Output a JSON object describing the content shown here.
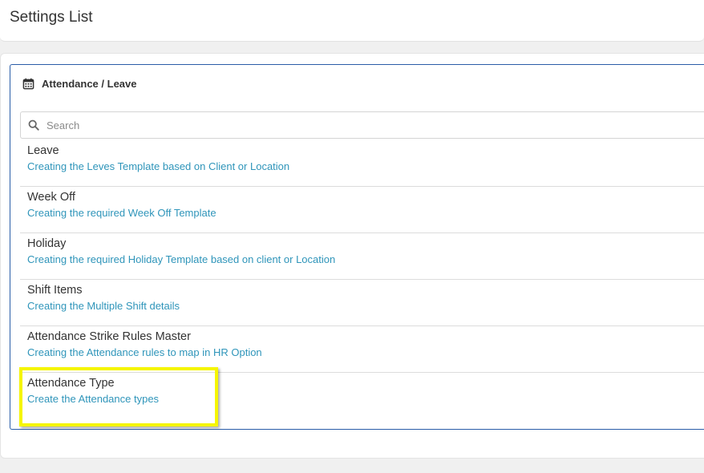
{
  "header": {
    "title": "Settings List"
  },
  "panel": {
    "title": "Attendance / Leave",
    "icon": "calendar-icon"
  },
  "search": {
    "placeholder": "Search",
    "value": "",
    "icon": "search-icon"
  },
  "items": [
    {
      "title": "Leave",
      "description": "Creating the Leves Template based on Client or Location"
    },
    {
      "title": "Week Off",
      "description": "Creating the required Week Off Template"
    },
    {
      "title": "Holiday",
      "description": "Creating the required Holiday Template based on client or Location"
    },
    {
      "title": "Shift Items",
      "description": "Creating the Multiple Shift details"
    },
    {
      "title": "Attendance Strike Rules Master",
      "description": "Creating the Attendance rules to map in HR Option"
    },
    {
      "title": "Attendance Type",
      "description": "Create the Attendance types"
    }
  ],
  "colors": {
    "panel_border": "#2a5da8",
    "description_text": "#2f95ba",
    "highlight": "#f5f500"
  }
}
